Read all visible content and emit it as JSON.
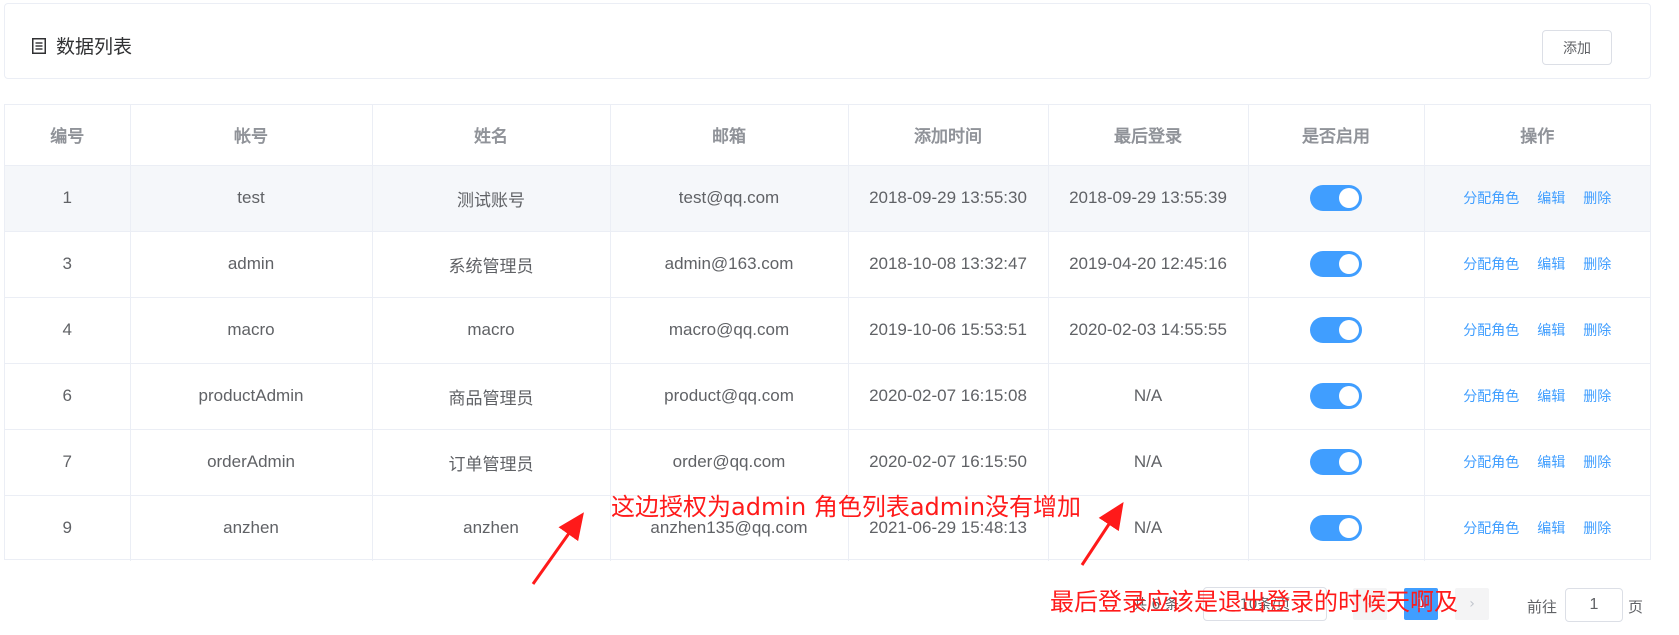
{
  "header": {
    "title": "数据列表",
    "add_label": "添加"
  },
  "table": {
    "columns": [
      "编号",
      "帐号",
      "姓名",
      "邮箱",
      "添加时间",
      "最后登录",
      "是否启用",
      "操作"
    ],
    "rows": [
      {
        "id": "1",
        "account": "test",
        "name": "测试账号",
        "email": "test@qq.com",
        "created": "2018-09-29 13:55:30",
        "last_login": "2018-09-29 13:55:39",
        "enabled": true
      },
      {
        "id": "3",
        "account": "admin",
        "name": "系统管理员",
        "email": "admin@163.com",
        "created": "2018-10-08 13:32:47",
        "last_login": "2019-04-20 12:45:16",
        "enabled": true
      },
      {
        "id": "4",
        "account": "macro",
        "name": "macro",
        "email": "macro@qq.com",
        "created": "2019-10-06 15:53:51",
        "last_login": "2020-02-03 14:55:55",
        "enabled": true
      },
      {
        "id": "6",
        "account": "productAdmin",
        "name": "商品管理员",
        "email": "product@qq.com",
        "created": "2020-02-07 16:15:08",
        "last_login": "N/A",
        "enabled": true
      },
      {
        "id": "7",
        "account": "orderAdmin",
        "name": "订单管理员",
        "email": "order@qq.com",
        "created": "2020-02-07 16:15:50",
        "last_login": "N/A",
        "enabled": true
      },
      {
        "id": "9",
        "account": "anzhen",
        "name": "anzhen",
        "email": "anzhen135@qq.com",
        "created": "2021-06-29 15:48:13",
        "last_login": "N/A",
        "enabled": true
      }
    ],
    "actions": {
      "assign_role": "分配角色",
      "edit": "编辑",
      "delete": "删除"
    }
  },
  "pagination": {
    "total_text": "共 6 条",
    "page_size_text": "10条/页",
    "prev_icon": "chevron-left-icon",
    "current_page": "1",
    "next_icon": "chevron-right-icon",
    "goto_label": "前往",
    "goto_value": "1",
    "goto_unit": "页"
  },
  "annotations": {
    "note_1": "这边授权为admin 角色列表admin没有增加",
    "note_2": "最后登录应该是退出登录的时候天啊及",
    "color": "#ff1a1a"
  },
  "colors": {
    "accent": "#409eff",
    "border": "#ebeef5",
    "header_text": "#909399"
  }
}
